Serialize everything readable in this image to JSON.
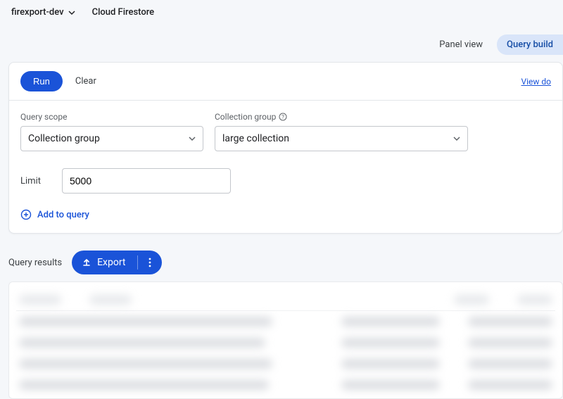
{
  "header": {
    "project": "firexport-dev",
    "product": "Cloud Firestore"
  },
  "viewTabs": {
    "panel": "Panel view",
    "builder": "Query build"
  },
  "builder": {
    "run": "Run",
    "clear": "Clear",
    "viewDocs": "View do",
    "scopeLabel": "Query scope",
    "scopeValue": "Collection group",
    "collLabel": "Collection group",
    "collValue": "large collection",
    "limitLabel": "Limit",
    "limitValue": "5000",
    "addToQuery": "Add to query"
  },
  "results": {
    "label": "Query results",
    "export": "Export"
  }
}
